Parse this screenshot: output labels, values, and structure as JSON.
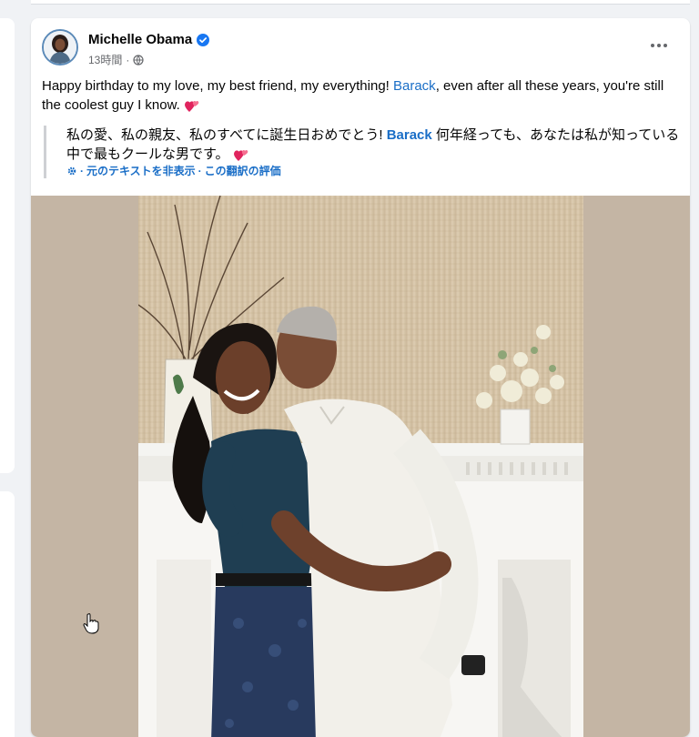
{
  "post": {
    "author": "Michelle Obama",
    "verified": true,
    "timestamp": "13時間",
    "separator": "·",
    "privacy_icon": "globe-icon",
    "more_icon": "more-horizontal-icon",
    "text_before": "Happy birthday to my love, my best friend, my everything! ",
    "mention": "Barack",
    "text_after": ", even after all these years, you're still the coolest guy I know. ",
    "translation": {
      "text_before": "私の愛、私の親友、私のすべてに誕生日おめでとう! ",
      "mention": "Barack",
      "text_after": " 何年経っても、あなたは私が知っている中で最もクールな男です。 ",
      "hide_original": "元のテキストを非表示",
      "rate_translation": "この翻訳の評価",
      "separator": "·"
    }
  },
  "colors": {
    "link": "#1a6ec7",
    "verified_badge": "#1877f2",
    "heart": "#e0245e",
    "photo_backdrop": "#c4b5a4"
  }
}
